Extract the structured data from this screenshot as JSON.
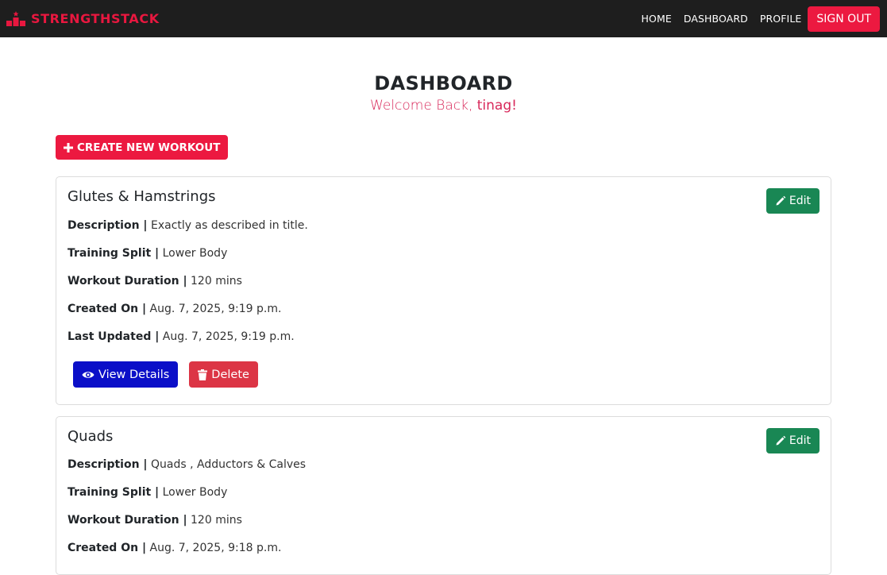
{
  "nav": {
    "brand": "STRENGTHSTACK",
    "links": [
      "HOME",
      "DASHBOARD",
      "PROFILE"
    ],
    "signout": "SIGN OUT",
    "icons": {
      "brand": "podium-icon"
    }
  },
  "header": {
    "title": "DASHBOARD",
    "welcome_prefix": "Welcome Back,",
    "username": "tinag!"
  },
  "create_button": {
    "label": "CREATE NEW WORKOUT",
    "icon": "plus-icon"
  },
  "workouts": [
    {
      "title": "Glutes & Hamstrings",
      "edit_label": "Edit",
      "fields": [
        {
          "label": "Description |",
          "value": "Exactly as described in title."
        },
        {
          "label": "Training Split |",
          "value": "Lower Body"
        },
        {
          "label": "Workout Duration |",
          "value": "120 mins"
        },
        {
          "label": "Created On |",
          "value": "Aug. 7, 2025, 9:19 p.m."
        },
        {
          "label": "Last Updated |",
          "value": "Aug. 7, 2025, 9:19 p.m."
        }
      ],
      "view_label": "View Details",
      "delete_label": "Delete"
    },
    {
      "title": "Quads",
      "edit_label": "Edit",
      "fields": [
        {
          "label": "Description |",
          "value": "Quads , Adductors & Calves"
        },
        {
          "label": "Training Split |",
          "value": "Lower Body"
        },
        {
          "label": "Workout Duration |",
          "value": "120 mins"
        },
        {
          "label": "Created On |",
          "value": "Aug. 7, 2025, 9:18 p.m."
        }
      ]
    }
  ],
  "colors": {
    "navbar": "#1e1e1e",
    "accent": "#ec1940",
    "edit": "#198754",
    "view": "#0b0fc8",
    "delete": "#dc3545",
    "welcome": "#d8285a"
  }
}
